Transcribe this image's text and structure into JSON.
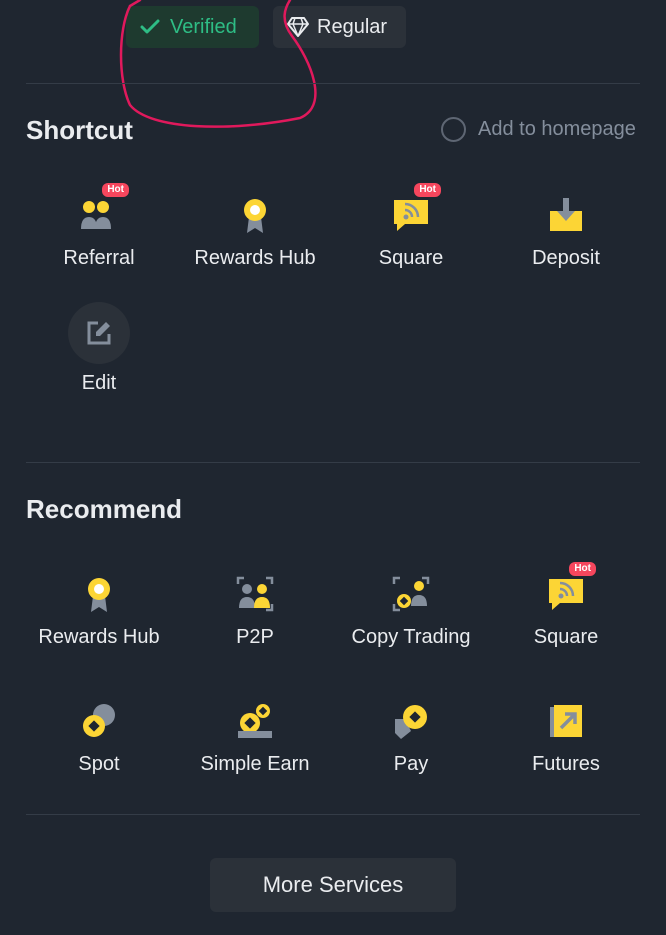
{
  "badges": {
    "verified": "Verified",
    "regular": "Regular"
  },
  "shortcut": {
    "title": "Shortcut",
    "add_to_homepage": "Add to homepage",
    "items": [
      {
        "label": "Referral",
        "icon": "referral-icon",
        "hot": "Hot"
      },
      {
        "label": "Rewards Hub",
        "icon": "rewards-hub-icon"
      },
      {
        "label": "Square",
        "icon": "square-icon",
        "hot": "Hot"
      },
      {
        "label": "Deposit",
        "icon": "deposit-icon"
      },
      {
        "label": "Edit",
        "icon": "edit-icon"
      }
    ]
  },
  "recommend": {
    "title": "Recommend",
    "items": [
      {
        "label": "Rewards Hub",
        "icon": "rewards-hub-icon"
      },
      {
        "label": "P2P",
        "icon": "p2p-icon"
      },
      {
        "label": "Copy Trading",
        "icon": "copy-trading-icon"
      },
      {
        "label": "Square",
        "icon": "square-icon",
        "hot": "Hot"
      },
      {
        "label": "Spot",
        "icon": "spot-icon"
      },
      {
        "label": "Simple Earn",
        "icon": "simple-earn-icon"
      },
      {
        "label": "Pay",
        "icon": "pay-icon"
      },
      {
        "label": "Futures",
        "icon": "futures-icon"
      }
    ]
  },
  "more_services": "More Services",
  "colors": {
    "background": "#1f2630",
    "accent_yellow": "#fcd535",
    "verified_green": "#2ebd85",
    "hot_red": "#f6465d",
    "annotation_pink": "#e0195c"
  }
}
